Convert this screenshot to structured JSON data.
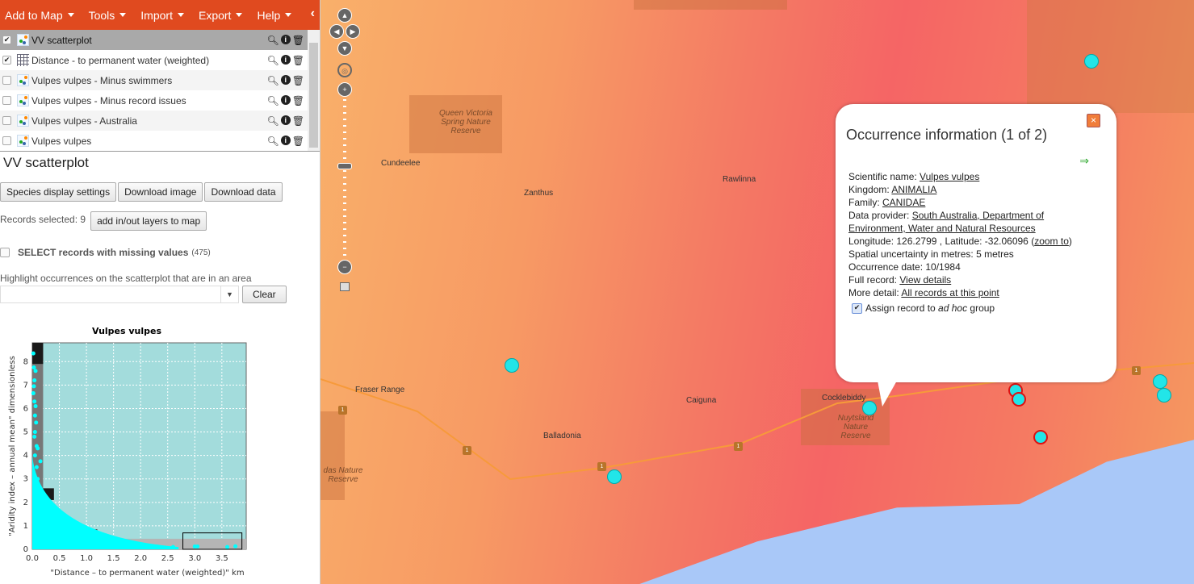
{
  "menu": [
    "Add to Map",
    "Tools",
    "Import",
    "Export",
    "Help"
  ],
  "layers": [
    {
      "label": "VV scatterplot",
      "checked": true,
      "type": "points",
      "selected": true
    },
    {
      "label": "Distance - to permanent water (weighted)",
      "checked": true,
      "type": "grid"
    },
    {
      "label": "Vulpes vulpes - Minus swimmers",
      "checked": false,
      "type": "points"
    },
    {
      "label": "Vulpes vulpes - Minus record issues",
      "checked": false,
      "type": "points"
    },
    {
      "label": "Vulpes vulpes - Australia",
      "checked": false,
      "type": "points"
    },
    {
      "label": "Vulpes vulpes",
      "checked": false,
      "type": "points"
    }
  ],
  "panel": {
    "title": "VV scatterplot",
    "buttons": [
      "Species display settings",
      "Download image",
      "Download data"
    ],
    "records_selected": "Records selected: 9",
    "add_layers": "add in/out layers to map",
    "missing_label": "SELECT records with missing values",
    "missing_count": "(475)",
    "highlight_label": "Highlight occurrences on the scatterplot that are in an area",
    "area_value": "",
    "clear": "Clear"
  },
  "chart_data": {
    "type": "scatter",
    "title": "Vulpes vulpes",
    "xlabel": "\"Distance – to permanent water (weighted)\" km",
    "ylabel": "\"Aridity index – annual mean\" dimensionless",
    "xlim": [
      0,
      3.95
    ],
    "ylim": [
      0,
      8.8
    ],
    "xticks": [
      "0.0",
      "0.5",
      "1.0",
      "1.5",
      "2.0",
      "2.5",
      "3.0",
      "3.5"
    ],
    "yticks": [
      "0",
      "1",
      "2",
      "3",
      "4",
      "5",
      "6",
      "7",
      "8"
    ],
    "grid": true,
    "point_color": "#00ffff",
    "background": "#a3dcdc",
    "points": [
      [
        0.02,
        8.35
      ],
      [
        0.03,
        7.75
      ],
      [
        0.06,
        7.6
      ],
      [
        0.04,
        7.2
      ],
      [
        0.03,
        6.95
      ],
      [
        0.02,
        6.65
      ],
      [
        0.04,
        6.3
      ],
      [
        0.06,
        6.1
      ],
      [
        0.05,
        5.7
      ],
      [
        0.07,
        5.4
      ],
      [
        0.05,
        5.0
      ],
      [
        0.04,
        4.8
      ],
      [
        0.08,
        4.4
      ],
      [
        0.1,
        4.3
      ],
      [
        0.05,
        4.0
      ],
      [
        0.15,
        3.75
      ],
      [
        0.08,
        3.5
      ],
      [
        0.1,
        3.0
      ],
      [
        0.12,
        2.5
      ],
      [
        0.29,
        1.85
      ],
      [
        0.25,
        1.7
      ],
      [
        0.26,
        1.4
      ],
      [
        0.2,
        1.2
      ],
      [
        0.3,
        0.95
      ],
      [
        0.5,
        0.85
      ],
      [
        0.6,
        0.65
      ],
      [
        0.8,
        0.5
      ],
      [
        1.0,
        0.4
      ],
      [
        1.3,
        0.3
      ],
      [
        1.6,
        0.25
      ],
      [
        2.0,
        0.2
      ],
      [
        2.3,
        0.12
      ],
      [
        2.6,
        0.1
      ],
      [
        3.0,
        0.12
      ],
      [
        3.05,
        0.12
      ],
      [
        3.6,
        0.1
      ],
      [
        3.75,
        0.13
      ]
    ],
    "selection_box": {
      "x": [
        2.78,
        3.87
      ],
      "y": [
        0,
        0.7
      ]
    }
  },
  "map": {
    "places": [
      "Cundeelee",
      "Zanthus",
      "Rawlinna",
      "Fraser Range",
      "Caiguna",
      "Balladonia",
      "Cocklebiddy"
    ],
    "reserves": [
      "Queen Victoria Spring Nature Reserve",
      "Nuytsland Nature Reserve",
      "das Nature Reserve"
    ],
    "road_shield": "1",
    "water_color": "#a9c8f8"
  },
  "popup": {
    "title": "Occurrence information (1 of 2)",
    "next_icon": "arrow-right-icon",
    "sci_label": "Scientific name: ",
    "sci": "Vulpes vulpes",
    "kingdom_label": "Kingdom: ",
    "kingdom": "ANIMALIA",
    "family_label": "Family: ",
    "family": "CANIDAE",
    "provider_label": "Data provider: ",
    "provider": "South Australia, Department of Environment, Water and Natural Resources",
    "coords": "Longitude: 126.2799 , Latitude: -32.06096 (",
    "zoom_to": "zoom to",
    "coords_end": ")",
    "uncertainty": "Spatial uncertainty in metres: 5 metres",
    "date": "Occurrence date: 10/1984",
    "full_label": "Full record: ",
    "full": "View details",
    "more_label": "More detail: ",
    "more": "All records at this point",
    "assign_pre": "Assign record to ",
    "assign_em": "ad hoc",
    "assign_post": " group",
    "assign_checked": true
  }
}
